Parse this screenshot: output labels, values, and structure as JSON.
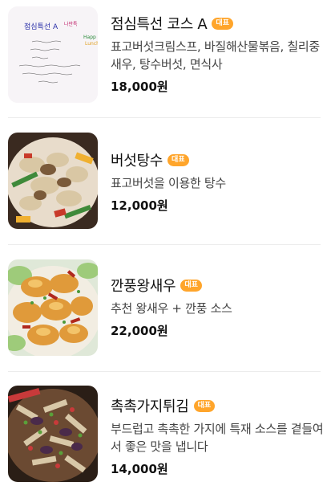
{
  "menu_items": [
    {
      "name": "점심특선 코스 A",
      "badge": "대표",
      "description": "표고버섯크림스프, 바질해산물볶음, 칠리중새우, 탕수버섯, 면식사",
      "price": "18,000원",
      "image_icon": "handwritten-menu-card-image"
    },
    {
      "name": "버섯탕수",
      "badge": "대표",
      "description": "표고버섯을 이용한 탕수",
      "price": "12,000원",
      "image_icon": "mushroom-sweet-sour-dish-image"
    },
    {
      "name": "깐풍왕새우",
      "badge": "대표",
      "description": "추천 왕새우 + 깐풍 소스",
      "price": "22,000원",
      "image_icon": "kkanpung-shrimp-dish-image"
    },
    {
      "name": "촉촉가지튀김",
      "badge": "대표",
      "description": "부드럽고 촉촉한 가지에 특재 소스를 곁들여서 좋은 맛을 냅니다",
      "price": "14,000원",
      "image_icon": "fried-eggplant-dish-image"
    }
  ],
  "colors": {
    "badge": "#ffa52b",
    "divider": "#ececec",
    "title": "#111111",
    "description": "#444444"
  }
}
